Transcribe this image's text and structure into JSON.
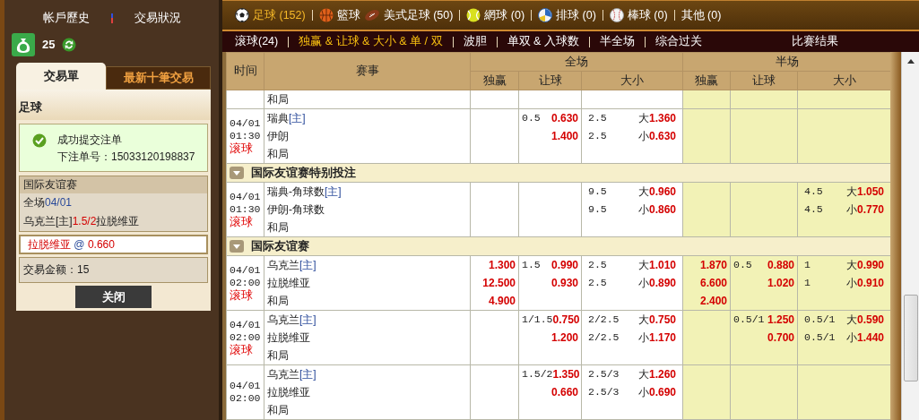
{
  "sidebar": {
    "links": [
      "帐戶歷史",
      "交易狀況"
    ],
    "balance": "25",
    "tabs": [
      {
        "label": "交易單",
        "selected": true
      },
      {
        "label": "最新十筆交易",
        "selected": false
      }
    ],
    "sport": "足球",
    "success": {
      "message": "成功提交注单",
      "order_label": "下注单号：",
      "order_no": "15033120198837"
    },
    "bet": {
      "league": "国际友谊赛",
      "period": "全场",
      "date": "04/01",
      "home": "乌克兰[主]",
      "handicap": "1.5/2",
      "away": "拉脱维亚"
    },
    "selection": {
      "team": "拉脱维亚",
      "at": "@",
      "odds": "0.660"
    },
    "amount": {
      "label": "交易金额：",
      "value": "15"
    },
    "close_button": "关闭"
  },
  "sports": [
    {
      "kind": "soccer",
      "label": "足球 (152)",
      "selected": true,
      "divider": true
    },
    {
      "kind": "basketball",
      "label": "籃球",
      "selected": false,
      "divider": false
    },
    {
      "kind": "football",
      "label": "美式足球 (50)",
      "selected": false,
      "divider": true
    },
    {
      "kind": "tennis",
      "label": "網球 (0)",
      "selected": false,
      "divider": true
    },
    {
      "kind": "volleyball",
      "label": "排球 (0)",
      "selected": false,
      "divider": true
    },
    {
      "kind": "baseball",
      "label": "棒球 (0)",
      "selected": false,
      "divider": true
    },
    {
      "kind": "other",
      "label": "其他 (0)",
      "selected": false,
      "divider": false
    }
  ],
  "bet_types": [
    {
      "label": "滚球(24)",
      "selected": false
    },
    {
      "label": "独赢 & 让球 & 大小 & 单 / 双",
      "selected": true
    },
    {
      "label": "波胆",
      "selected": false
    },
    {
      "label": "单双 & 入球数",
      "selected": false
    },
    {
      "label": "半全场",
      "selected": false
    },
    {
      "label": "综合过关",
      "selected": false
    }
  ],
  "results_link": "比赛结果",
  "table": {
    "columns": {
      "time": "时间",
      "match": "赛事",
      "full": "全场",
      "half": "半场",
      "sub": [
        "独赢",
        "让球",
        "大小",
        "独赢",
        "让球",
        "大小"
      ]
    },
    "rows": [
      {
        "kind": "match",
        "teams": [
          {
            "name": "和局"
          }
        ]
      },
      {
        "kind": "match",
        "date": "04/01",
        "time": "01:30",
        "live": "滚球",
        "teams": [
          {
            "name": "瑞典",
            "tag": "[主]"
          },
          {
            "name": "伊朗"
          },
          {
            "name": "和局"
          }
        ],
        "ft_hdp": [
          {
            "line": "0.5",
            "odds": "0.630"
          },
          {
            "odds": "1.400"
          }
        ],
        "ft_ou": [
          {
            "line": "2.5",
            "side": "大",
            "odds": "1.360"
          },
          {
            "line": "2.5",
            "side": "小",
            "odds": "0.630"
          }
        ]
      },
      {
        "kind": "league",
        "name": "国际友谊赛特别投注"
      },
      {
        "kind": "match",
        "date": "04/01",
        "time": "01:30",
        "live": "滚球",
        "teams": [
          {
            "name": "瑞典-角球数",
            "tag": "[主]"
          },
          {
            "name": "伊朗-角球数"
          },
          {
            "name": "和局"
          }
        ],
        "ft_ou": [
          {
            "line": "9.5",
            "side": "大",
            "odds": "0.960"
          },
          {
            "line": "9.5",
            "side": "小",
            "odds": "0.860"
          }
        ],
        "hf_ou": [
          {
            "line": "4.5",
            "side": "大",
            "odds": "1.050"
          },
          {
            "line": "4.5",
            "side": "小",
            "odds": "0.770"
          }
        ]
      },
      {
        "kind": "league",
        "name": "国际友谊赛"
      },
      {
        "kind": "match",
        "date": "04/01",
        "time": "02:00",
        "live": "滚球",
        "teams": [
          {
            "name": "乌克兰",
            "tag": "[主]"
          },
          {
            "name": "拉脱维亚"
          },
          {
            "name": "和局"
          }
        ],
        "ft_1x2": [
          "1.300",
          "12.500",
          "4.900"
        ],
        "ft_hdp": [
          {
            "line": "1.5",
            "odds": "0.990"
          },
          {
            "odds": "0.930"
          }
        ],
        "ft_ou": [
          {
            "line": "2.5",
            "side": "大",
            "odds": "1.010"
          },
          {
            "line": "2.5",
            "side": "小",
            "odds": "0.890"
          }
        ],
        "hf_1x2": [
          "1.870",
          "6.600",
          "2.400"
        ],
        "hf_hdp": [
          {
            "line": "0.5",
            "odds": "0.880"
          },
          {
            "odds": "1.020"
          }
        ],
        "hf_ou": [
          {
            "line": "1",
            "side": "大",
            "odds": "0.990"
          },
          {
            "line": "1",
            "side": "小",
            "odds": "0.910"
          }
        ]
      },
      {
        "kind": "match",
        "date": "04/01",
        "time": "02:00",
        "live": "滚球",
        "teams": [
          {
            "name": "乌克兰",
            "tag": "[主]"
          },
          {
            "name": "拉脱维亚"
          },
          {
            "name": "和局"
          }
        ],
        "ft_hdp": [
          {
            "line": "1/1.5",
            "odds": "0.750"
          },
          {
            "odds": "1.200"
          }
        ],
        "ft_ou": [
          {
            "line": "2/2.5",
            "side": "大",
            "odds": "0.750"
          },
          {
            "line": "2/2.5",
            "side": "小",
            "odds": "1.170"
          }
        ],
        "hf_hdp": [
          {
            "line": "0.5/1",
            "odds": "1.250"
          },
          {
            "odds": "0.700"
          }
        ],
        "hf_ou": [
          {
            "line": "0.5/1",
            "side": "大",
            "odds": "0.590"
          },
          {
            "line": "0.5/1",
            "side": "小",
            "odds": "1.440"
          }
        ]
      },
      {
        "kind": "match",
        "date": "04/01",
        "time": "02:00",
        "teams": [
          {
            "name": "乌克兰",
            "tag": "[主]"
          },
          {
            "name": "拉脱维亚"
          },
          {
            "name": "和局"
          }
        ],
        "ft_hdp": [
          {
            "line": "1.5/2",
            "odds": "1.350"
          },
          {
            "odds": "0.660"
          }
        ],
        "ft_ou": [
          {
            "line": "2.5/3",
            "side": "大",
            "odds": "1.260"
          },
          {
            "line": "2.5/3",
            "side": "小",
            "odds": "0.690"
          }
        ]
      }
    ]
  }
}
